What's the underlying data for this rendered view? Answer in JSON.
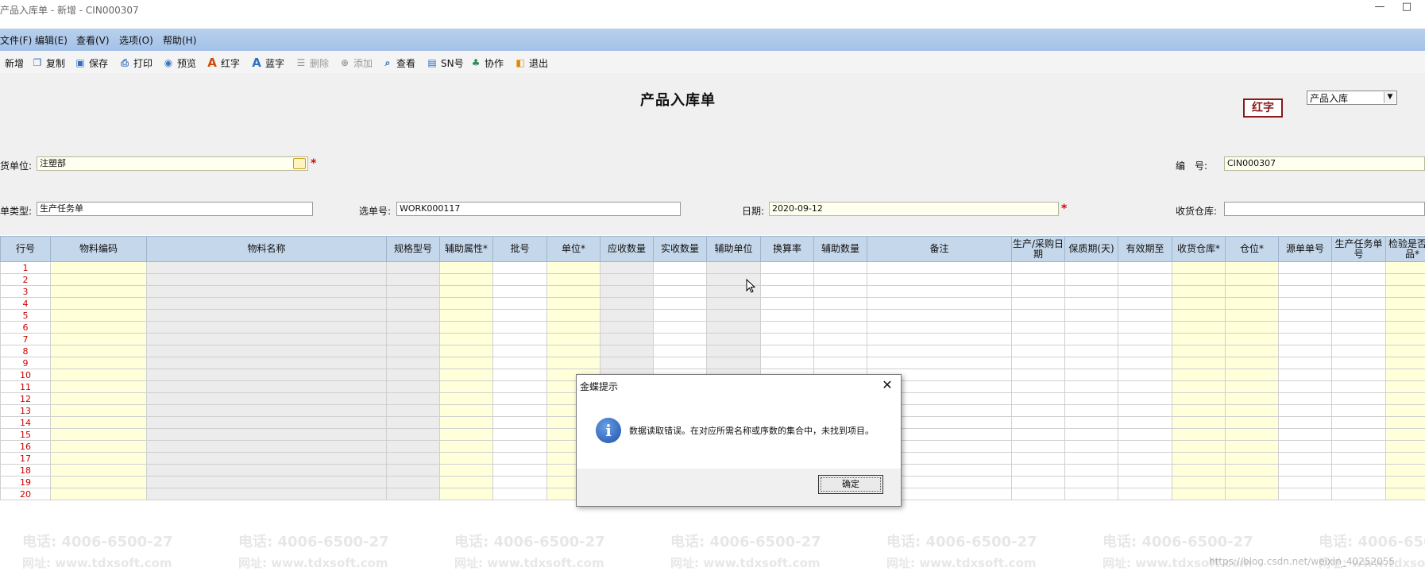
{
  "window": {
    "title": "产品入库单 - 新增 - CIN000307",
    "minimize_glyph": "—",
    "maximize_glyph": "□"
  },
  "menu": [
    "文件(F)",
    "编辑(E)",
    "查看(V)",
    "选项(O)",
    "帮助(H)"
  ],
  "toolbar": [
    {
      "label": "新增",
      "icon": "new-icon",
      "enabled": true
    },
    {
      "label": "复制",
      "icon": "copy-icon",
      "enabled": true
    },
    {
      "label": "保存",
      "icon": "save-icon",
      "enabled": true
    },
    {
      "label": "打印",
      "icon": "print-icon",
      "enabled": true
    },
    {
      "label": "预览",
      "icon": "preview-icon",
      "enabled": true
    },
    {
      "label": "红字",
      "icon": "red-letter-icon",
      "enabled": true
    },
    {
      "label": "蓝字",
      "icon": "blue-letter-icon",
      "enabled": true
    },
    {
      "label": "删除",
      "icon": "delete-icon",
      "enabled": false
    },
    {
      "label": "添加",
      "icon": "add-icon",
      "enabled": false
    },
    {
      "label": "查看",
      "icon": "view-icon",
      "enabled": true
    },
    {
      "label": "SN号",
      "icon": "sn-icon",
      "enabled": true
    },
    {
      "label": "协作",
      "icon": "collaborate-icon",
      "enabled": true
    },
    {
      "label": "退出",
      "icon": "exit-icon",
      "enabled": true
    }
  ],
  "form": {
    "title": "产品入库单",
    "red_badge": "红字",
    "doc_type": "产品入库",
    "supplier_label": "货单位:",
    "supplier_value": "注塑部",
    "number_label": "编　号:",
    "number_value": "CIN000307",
    "source_type_label": "单类型:",
    "source_type_value": "生产任务单",
    "select_no_label": "选单号:",
    "select_no_value": "WORK000117",
    "date_label": "日期:",
    "date_value": "2020-09-12",
    "warehouse_label": "收货仓库:",
    "warehouse_value": "",
    "required_mark": "*"
  },
  "grid": {
    "columns": [
      "行号",
      "物料编码",
      "物料名称",
      "规格型号",
      "辅助属性*",
      "批号",
      "单位*",
      "应收数量",
      "实收数量",
      "辅助单位",
      "换算率",
      "辅助数量",
      "备注",
      "生产/采购日期",
      "保质期(天)",
      "有效期至",
      "收货仓库*",
      "仓位*",
      "源单单号",
      "生产任务单号",
      "检验是否良品*"
    ],
    "rows": [
      "1",
      "2",
      "3",
      "4",
      "5",
      "6",
      "7",
      "8",
      "9",
      "10",
      "11",
      "12",
      "13",
      "14",
      "15",
      "16",
      "17",
      "18",
      "19",
      "20"
    ]
  },
  "watermark": {
    "phone": "电话: 4006-6500-27",
    "site": "网址: www.tdxsoft.com"
  },
  "dialog": {
    "title": "金蝶提示",
    "message": "数据读取错误。在对应所需名称或序数的集合中，未找到项目。",
    "ok_label": "确定",
    "close_glyph": "✕",
    "icon": "info-icon"
  },
  "footer": {
    "url": "https://blog.csdn.net/weixin_40252055"
  },
  "colors": {
    "menubar": "#a3c1e8",
    "grid_header": "#c5d7ea",
    "required_cell": "#ffffd9",
    "readonly_cell": "#ececec",
    "row_number": "#cc0000",
    "red_badge": "#8b1a1a"
  }
}
